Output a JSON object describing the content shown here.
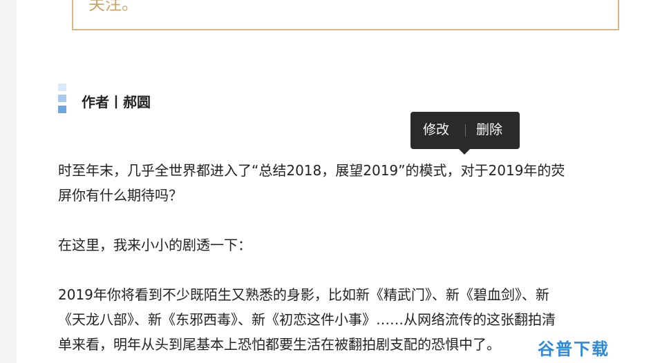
{
  "quote_box": {
    "text": "关注。"
  },
  "author": {
    "line": "作者丨郝圆"
  },
  "context_menu": {
    "edit_label": "修改",
    "delete_label": "删除"
  },
  "article": {
    "paragraphs": [
      {
        "lines": [
          "时至年末，几乎全世界都进入了“总结2018，展望2019”的模式，对于2019年的荧",
          "屏你有什么期待吗？"
        ]
      },
      {
        "lines": [
          "在这里，我来小小的剧透一下："
        ]
      },
      {
        "lines": [
          "2019年你将看到不少既陌生又熟悉的身影，比如新《精武门》、新《碧血剑》、新",
          "《天龙八部》、新《东邪西毒》、新《初恋这件小事》……从网络流传的这张翻拍清",
          "单来看，明年从头到尾基本上恐怕都要生活在被翻拍剧支配的恐惧中了。"
        ]
      }
    ]
  },
  "watermark": {
    "text": "谷普下载"
  },
  "colors": {
    "quote_border": "#d8b683",
    "quote_text": "#c9a46b",
    "menu_bg": "#2a2a2a",
    "watermark": "#2e8ad8"
  }
}
